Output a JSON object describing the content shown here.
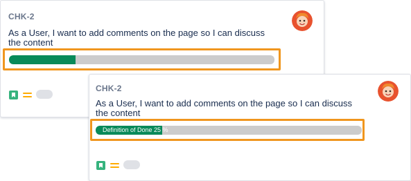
{
  "cards": [
    {
      "key": "CHK-2",
      "summary_line1": "As a User, I want to add comments on the page so I can discuss",
      "summary_line2": "the content",
      "progress": {
        "value": 0.25,
        "label": ""
      },
      "avatar": "user-avatar",
      "issue_type_icon": "story-icon",
      "priority_icon": "priority-medium-icon"
    },
    {
      "key": "CHK-2",
      "summary_line1": "As a User, I want to add comments on the page so I can discuss",
      "summary_line2": "the content",
      "progress": {
        "value": 0.25,
        "label": "Definition of Done 25 %"
      },
      "avatar": "user-avatar",
      "issue_type_icon": "story-icon",
      "priority_icon": "priority-medium-icon"
    }
  ],
  "colors": {
    "progress_fill": "#098a59",
    "progress_track": "#cccccc",
    "highlight_border": "#f0961e",
    "story": "#36b37e",
    "priority": "#ffab00"
  }
}
